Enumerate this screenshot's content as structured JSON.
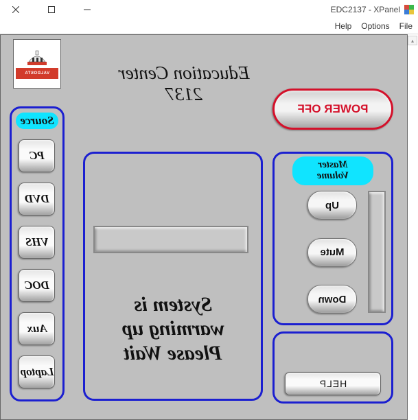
{
  "window": {
    "title": "EDC2137 - XPanel",
    "menu": {
      "file": "File",
      "options": "Options",
      "help": "Help"
    }
  },
  "header": {
    "title_line1": "Education Center",
    "title_line2": "2137"
  },
  "logo": {
    "text": "VALDOSTA"
  },
  "power_off_label": "POWER OFF",
  "source": {
    "title": "Source",
    "buttons": {
      "pc": "PC",
      "dvd": "DVD",
      "vhs": "VHS",
      "doc": "DOC",
      "aux": "Aux",
      "laptop": "Laptop"
    }
  },
  "status": {
    "line1": "System is",
    "line2": "warming up",
    "line3": "Please Wait"
  },
  "master_volume": {
    "title": "Master Volume",
    "up": "Up",
    "mute": "Mute",
    "down": "Down"
  },
  "help_label": "HELP"
}
